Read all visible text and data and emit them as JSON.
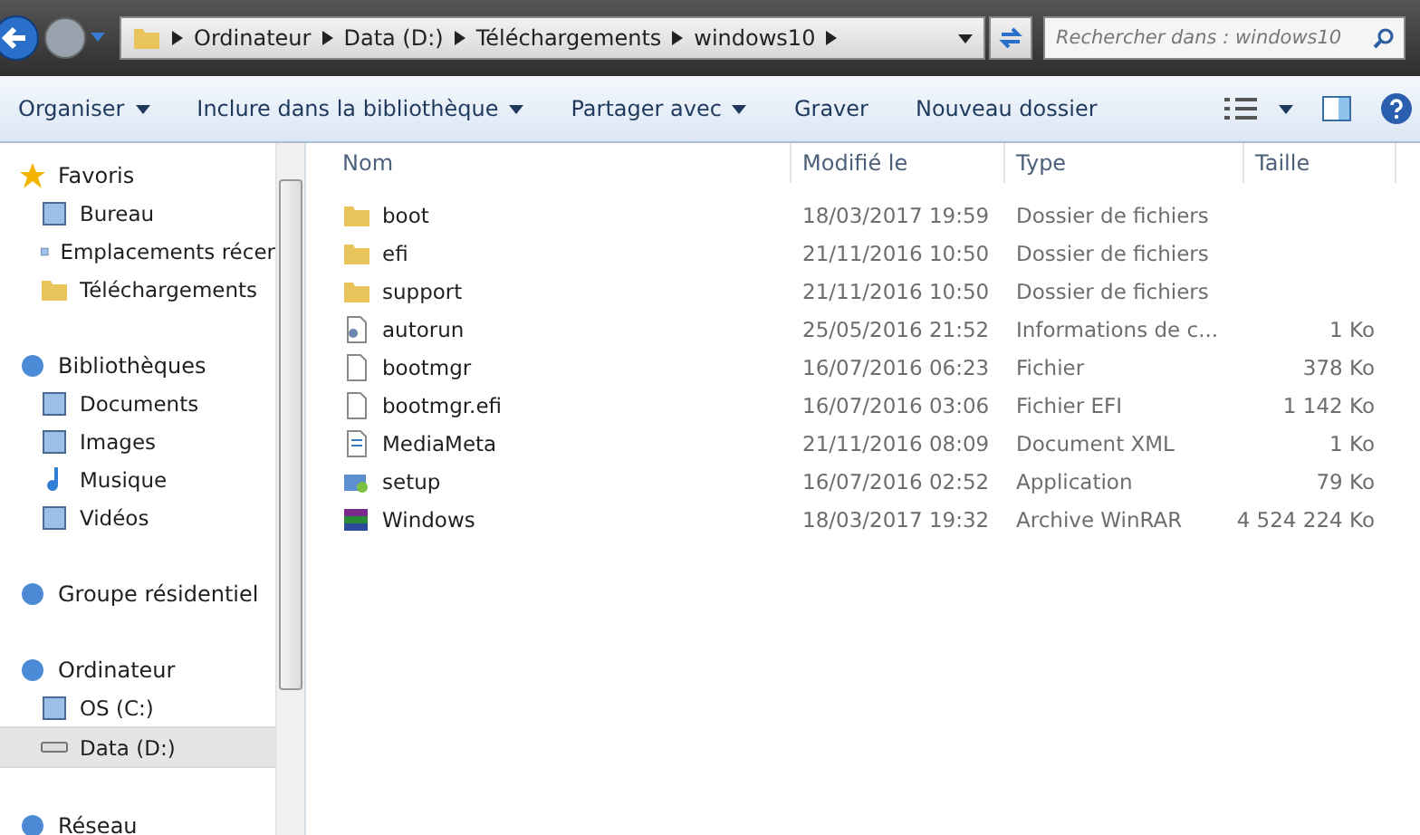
{
  "address": {
    "crumbs": [
      "Ordinateur",
      "Data (D:)",
      "Téléchargements",
      "windows10"
    ]
  },
  "search": {
    "placeholder": "Rechercher dans : windows10"
  },
  "toolbar": [
    {
      "label": "Organiser",
      "dropdown": true
    },
    {
      "label": "Inclure dans la bibliothèque",
      "dropdown": true
    },
    {
      "label": "Partager avec",
      "dropdown": true
    },
    {
      "label": "Graver",
      "dropdown": false
    },
    {
      "label": "Nouveau dossier",
      "dropdown": false
    }
  ],
  "sidebar": {
    "groups": [
      {
        "label": "Favoris",
        "children": [
          {
            "label": "Bureau",
            "selected": false
          },
          {
            "label": "Emplacements récer",
            "selected": false
          },
          {
            "label": "Téléchargements",
            "selected": false
          }
        ]
      },
      {
        "label": "Bibliothèques",
        "children": [
          {
            "label": "Documents",
            "selected": false
          },
          {
            "label": "Images",
            "selected": false
          },
          {
            "label": "Musique",
            "selected": false
          },
          {
            "label": "Vidéos",
            "selected": false
          }
        ]
      },
      {
        "label": "Groupe résidentiel"
      },
      {
        "label": "Ordinateur",
        "children": [
          {
            "label": "OS (C:)",
            "selected": false
          },
          {
            "label": "Data (D:)",
            "selected": true
          }
        ]
      },
      {
        "label": "Réseau"
      }
    ]
  },
  "table": {
    "columns": [
      "Nom",
      "Modifié le",
      "Type",
      "Taille"
    ],
    "rows": [
      {
        "kind": "folder",
        "name": "boot",
        "modified": "18/03/2017 19:59",
        "type": "Dossier de fichiers"
      },
      {
        "kind": "folder",
        "name": "efi",
        "modified": "21/11/2016 10:50",
        "type": "Dossier de fichiers"
      },
      {
        "kind": "folder",
        "name": "support",
        "modified": "21/11/2016 10:50",
        "type": "Dossier de fichiers"
      },
      {
        "kind": "config",
        "name": "autorun",
        "modified": "25/05/2016 21:52",
        "type": "Informations de c...",
        "size": "1 Ko"
      },
      {
        "kind": "file",
        "name": "bootmgr",
        "modified": "16/07/2016 06:23",
        "type": "Fichier",
        "size": "378 Ko"
      },
      {
        "kind": "file",
        "name": "bootmgr.efi",
        "modified": "16/07/2016 03:06",
        "type": "Fichier EFI",
        "size": "1 142 Ko"
      },
      {
        "kind": "xml",
        "name": "MediaMeta",
        "modified": "21/11/2016 08:09",
        "type": "Document XML",
        "size": "1 Ko"
      },
      {
        "kind": "app",
        "name": "setup",
        "modified": "16/07/2016 02:52",
        "type": "Application",
        "size": "79 Ko"
      },
      {
        "kind": "archive",
        "name": "Windows",
        "modified": "18/03/2017 19:32",
        "type": "Archive WinRAR",
        "size": "4 524 224 Ko"
      }
    ]
  }
}
